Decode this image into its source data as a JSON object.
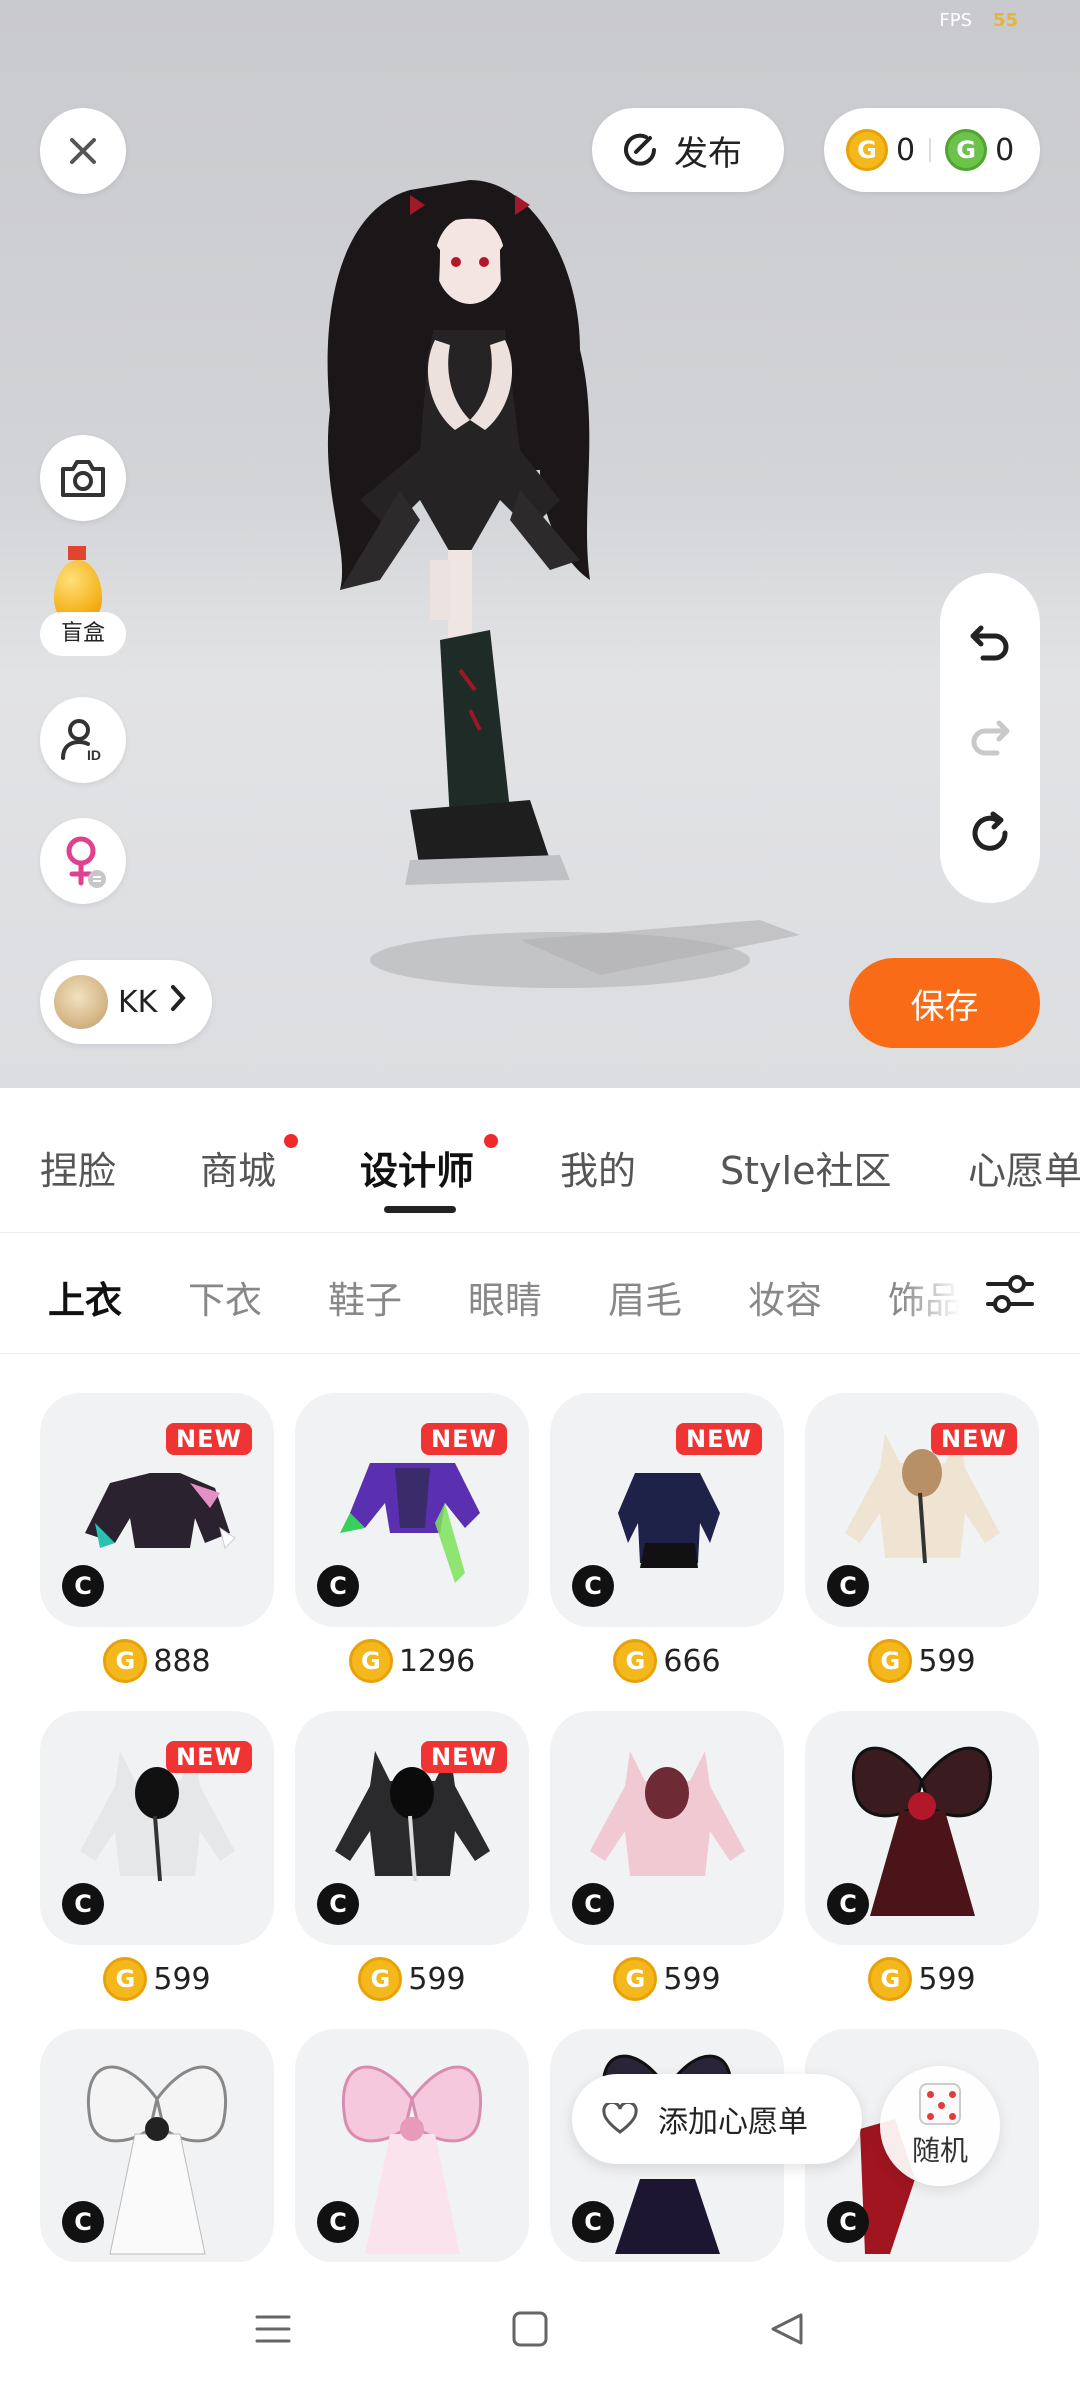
{
  "status": {
    "fps_label": "FPS",
    "fps_value": "55"
  },
  "header": {
    "close_icon": "close-icon",
    "publish_label": "发布",
    "currency": {
      "gold": "0",
      "green": "0"
    }
  },
  "left_tools": {
    "blindbox_label": "盲盒",
    "user_name": "KK"
  },
  "actions": {
    "save_label": "保存"
  },
  "main_tabs": [
    {
      "label": "捏脸",
      "dot": false
    },
    {
      "label": "商城",
      "dot": true
    },
    {
      "label": "设计师",
      "dot": true,
      "active": true
    },
    {
      "label": "我的",
      "dot": false
    },
    {
      "label": "Style社区",
      "dot": false
    },
    {
      "label": "心愿单",
      "dot": false
    }
  ],
  "sub_tabs": [
    {
      "label": "上衣",
      "active": true
    },
    {
      "label": "下衣"
    },
    {
      "label": "鞋子"
    },
    {
      "label": "眼睛"
    },
    {
      "label": "眉毛"
    },
    {
      "label": "妆容"
    },
    {
      "label": "饰品"
    }
  ],
  "items": [
    {
      "price": "888",
      "new": true
    },
    {
      "price": "1296",
      "new": true
    },
    {
      "price": "666",
      "new": true
    },
    {
      "price": "599",
      "new": true
    },
    {
      "price": "599",
      "new": true
    },
    {
      "price": "599",
      "new": true
    },
    {
      "price": "599",
      "new": false
    },
    {
      "price": "599",
      "new": false
    },
    {
      "price": "",
      "new": false
    },
    {
      "price": "",
      "new": false
    },
    {
      "price": "",
      "new": false
    },
    {
      "price": "",
      "new": false
    }
  ],
  "badges": {
    "new_label": "NEW",
    "creator_label": "C",
    "coin_symbol": "G"
  },
  "popup": {
    "wishlist_label": "添加心愿单",
    "random_label": "随机"
  },
  "colors": {
    "accent": "#fa6b17",
    "badge_red": "#f03434",
    "coin_gold": "#f5b81c",
    "coin_green": "#6cc24a"
  }
}
